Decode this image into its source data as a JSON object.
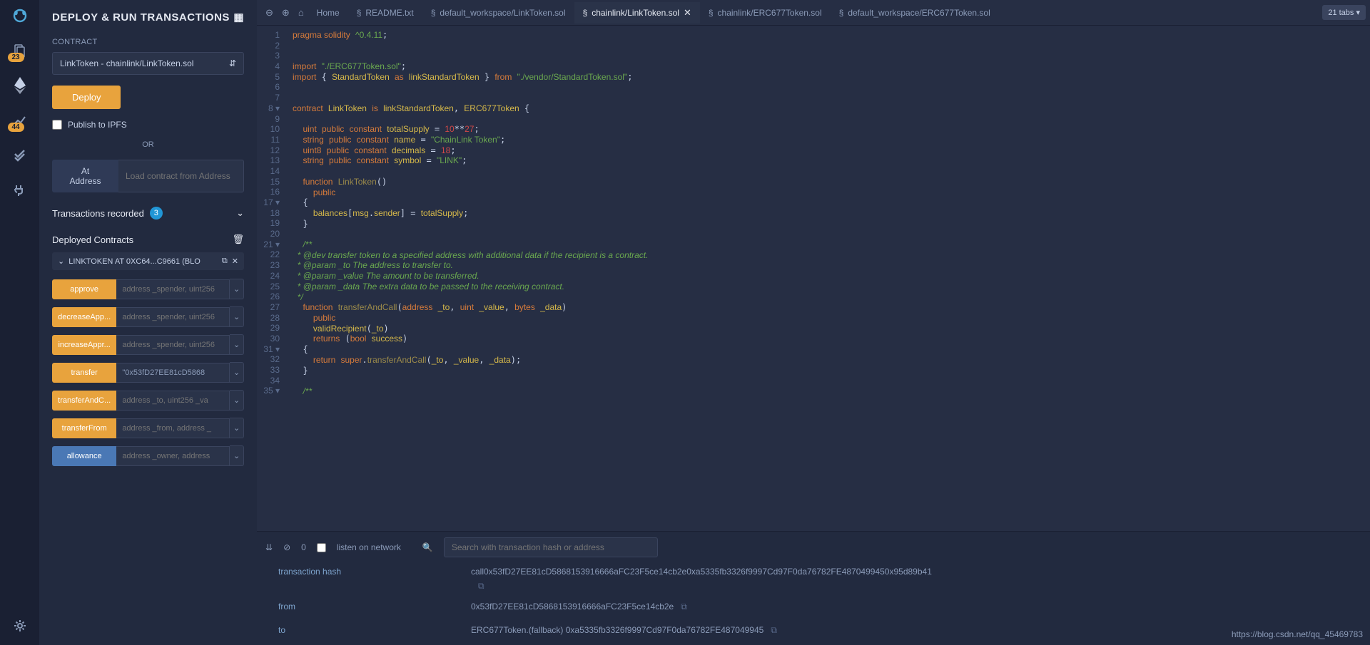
{
  "iconbar": {
    "badges": {
      "file": "23",
      "analyze": "44"
    }
  },
  "panel": {
    "title": "DEPLOY & RUN TRANSACTIONS",
    "contract_label": "CONTRACT",
    "contract_select": "LinkToken - chainlink/LinkToken.sol",
    "deploy_btn": "Deploy",
    "publish": "Publish to IPFS",
    "or": "OR",
    "ataddress": "At Address",
    "load_placeholder": "Load contract from Address",
    "trans_rec": "Transactions recorded",
    "trans_count": "3",
    "deployed": "Deployed Contracts",
    "instance": "LINKTOKEN AT 0XC64...C9661 (BLO",
    "functions": [
      {
        "name": "approve",
        "ph": "address _spender, uint256",
        "color": "orange"
      },
      {
        "name": "decreaseApp...",
        "ph": "address _spender, uint256",
        "color": "orange"
      },
      {
        "name": "increaseAppr...",
        "ph": "address _spender, uint256",
        "color": "orange"
      },
      {
        "name": "transfer",
        "ph": "\"0x53fD27EE81cD5868",
        "color": "orange",
        "val": "\"0x53fD27EE81cD5868"
      },
      {
        "name": "transferAndC...",
        "ph": "address _to, uint256 _va",
        "color": "orange"
      },
      {
        "name": "transferFrom",
        "ph": "address _from, address _",
        "color": "orange"
      },
      {
        "name": "allowance",
        "ph": "address _owner, address",
        "color": "blue"
      }
    ]
  },
  "tabs": {
    "home": "Home",
    "items": [
      {
        "label": "README.txt",
        "active": false
      },
      {
        "label": "default_workspace/LinkToken.sol",
        "active": false
      },
      {
        "label": "chainlink/LinkToken.sol",
        "active": true
      },
      {
        "label": "chainlink/ERC677Token.sol",
        "active": false
      },
      {
        "label": "default_workspace/ERC677Token.sol",
        "active": false
      }
    ],
    "count": "21 tabs"
  },
  "code_lines": [
    1,
    2,
    3,
    4,
    5,
    6,
    7,
    8,
    9,
    10,
    11,
    12,
    13,
    14,
    15,
    16,
    17,
    18,
    19,
    20,
    21,
    22,
    23,
    24,
    25,
    26,
    27,
    28,
    29,
    30,
    31,
    32,
    33,
    34,
    35
  ],
  "term": {
    "zero": "0",
    "listen": "listen on network",
    "search_ph": "Search with transaction hash or address",
    "rows": [
      {
        "k": "transaction hash",
        "v": "call0x53fD27EE81cD5868153916666aFC23F5ce14cb2e0xa5335fb3326f9997Cd97F0da76782FE4870499450x95d89b41"
      },
      {
        "k": "from",
        "v": "0x53fD27EE81cD5868153916666aFC23F5ce14cb2e"
      },
      {
        "k": "to",
        "v": "ERC677Token.(fallback) 0xa5335fb3326f9997Cd97F0da76782FE487049945"
      }
    ]
  },
  "watermark": "https://blog.csdn.net/qq_45469783"
}
